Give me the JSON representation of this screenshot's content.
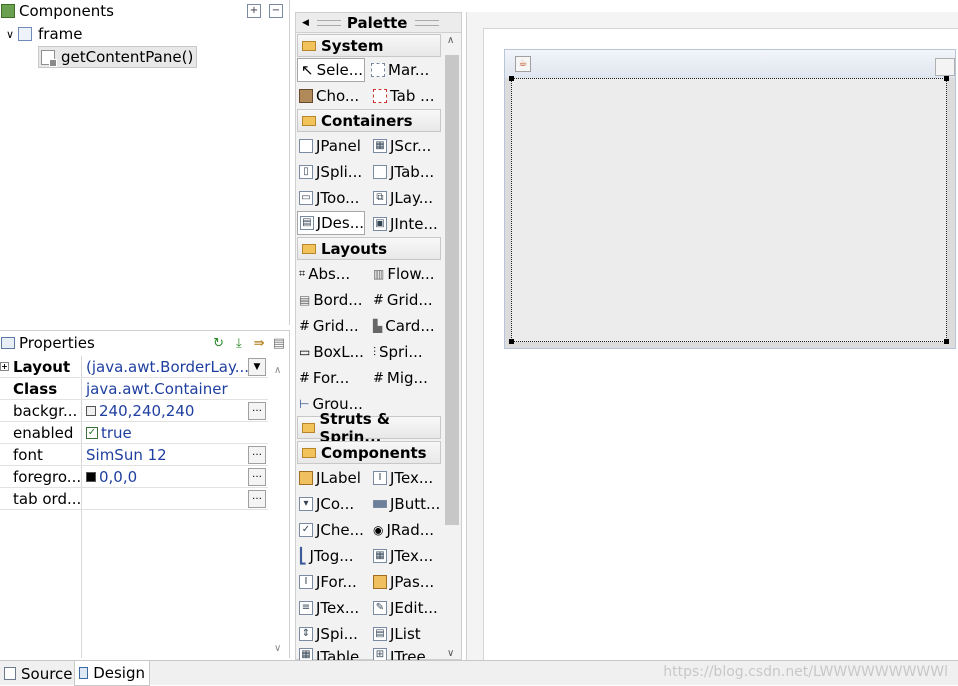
{
  "components_panel": {
    "title": "Components",
    "tree": [
      {
        "label": "frame"
      },
      {
        "label": "getContentPane()"
      }
    ]
  },
  "properties_panel": {
    "title": "Properties",
    "rows": [
      {
        "key": "Layout",
        "value": "(java.awt.BorderLay..."
      },
      {
        "key": "Class",
        "value": "java.awt.Container"
      },
      {
        "key": "backgr...",
        "value": "240,240,240"
      },
      {
        "key": "enabled",
        "value": "true"
      },
      {
        "key": "font",
        "value": "SimSun 12"
      },
      {
        "key": "foregro...",
        "value": "0,0,0"
      },
      {
        "key": "tab ord...",
        "value": ""
      }
    ],
    "colors": {
      "background_swatch": "#f0f0f0",
      "foreground_swatch": "#000000"
    }
  },
  "palette": {
    "title": "Palette",
    "categories": [
      {
        "name": "System",
        "items": [
          "Sele...",
          "Mar...",
          "Cho...",
          "Tab ..."
        ]
      },
      {
        "name": "Containers",
        "items": [
          "JPanel",
          "JScr...",
          "JSpli...",
          "JTab...",
          "JToo...",
          "JLay...",
          "JDes...",
          "JInte..."
        ]
      },
      {
        "name": "Layouts",
        "items": [
          "Abs...",
          "Flow...",
          "Bord...",
          "Grid...",
          "Grid...",
          "Card...",
          "BoxL...",
          "Spri...",
          "For...",
          "Mig...",
          "Grou..."
        ]
      },
      {
        "name": "Struts & Sprin..."
      },
      {
        "name": "Components",
        "items": [
          "JLabel",
          "JTex...",
          "JCo...",
          "JButt...",
          "JChe...",
          "JRad...",
          "JTog...",
          "JTex...",
          "JFor...",
          "JPas...",
          "JTex...",
          "JEdit...",
          "JSpi...",
          "JList",
          "JTable",
          "JTree"
        ]
      }
    ]
  },
  "bottom_tabs": {
    "source": "Source",
    "design": "Design",
    "watermark": "https://blog.csdn.net/LWWWWWWWWWl"
  }
}
